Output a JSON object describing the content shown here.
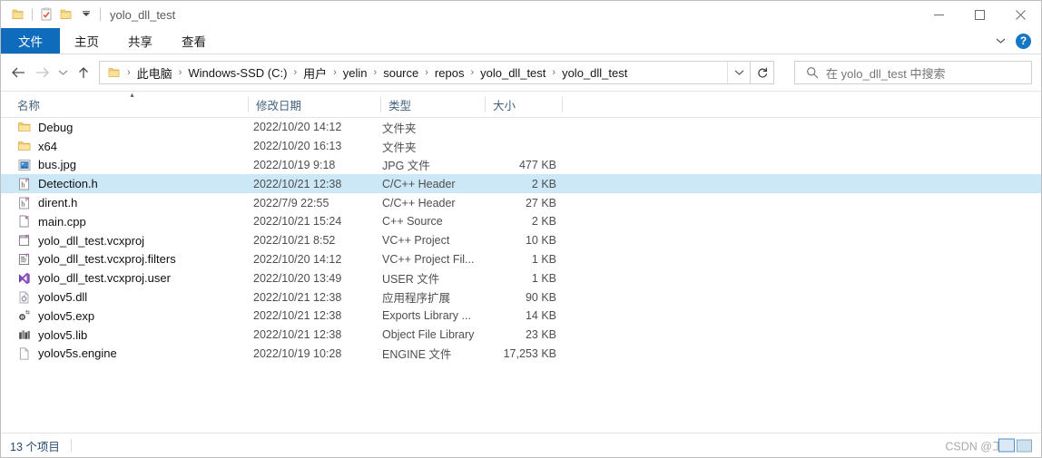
{
  "window": {
    "title": "yolo_dll_test",
    "controls": {
      "minimize": "—",
      "maximize": "□",
      "close": "✕"
    },
    "quick_access": [
      {
        "name": "folder-icon",
        "label": ""
      },
      {
        "name": "properties-icon",
        "label": ""
      },
      {
        "name": "new-folder-icon",
        "label": ""
      },
      {
        "name": "customize-dropdown-icon",
        "label": "▾"
      }
    ]
  },
  "ribbon": {
    "tabs": [
      {
        "label": "文件",
        "id": "file",
        "active": true
      },
      {
        "label": "主页",
        "id": "home",
        "active": false
      },
      {
        "label": "共享",
        "id": "share",
        "active": false
      },
      {
        "label": "查看",
        "id": "view",
        "active": false
      }
    ],
    "collapse_icon": "⌄",
    "help_icon": "?"
  },
  "addressbar": {
    "back": "←",
    "forward": "→",
    "recent": "⌄",
    "up": "↑",
    "breadcrumbs": [
      "此电脑",
      "Windows-SSD (C:)",
      "用户",
      "yelin",
      "source",
      "repos",
      "yolo_dll_test",
      "yolo_dll_test"
    ],
    "separator": "›",
    "dropdown": "⌄",
    "refresh": "↻"
  },
  "search": {
    "placeholder": "在 yolo_dll_test 中搜索",
    "icon": "search-icon"
  },
  "columns": [
    {
      "key": "name",
      "label": "名称",
      "sorted": "asc"
    },
    {
      "key": "date",
      "label": "修改日期"
    },
    {
      "key": "type",
      "label": "类型"
    },
    {
      "key": "size",
      "label": "大小"
    }
  ],
  "sort_caret": "▴",
  "files": [
    {
      "name": "Debug",
      "date": "2022/10/20 14:12",
      "type": "文件夹",
      "size": "",
      "icon": "folder",
      "selected": false
    },
    {
      "name": "x64",
      "date": "2022/10/20 16:13",
      "type": "文件夹",
      "size": "",
      "icon": "folder",
      "selected": false
    },
    {
      "name": "bus.jpg",
      "date": "2022/10/19 9:18",
      "type": "JPG 文件",
      "size": "477 KB",
      "icon": "image",
      "selected": false
    },
    {
      "name": "Detection.h",
      "date": "2022/10/21 12:38",
      "type": "C/C++ Header",
      "size": "2 KB",
      "icon": "header",
      "selected": true
    },
    {
      "name": "dirent.h",
      "date": "2022/7/9 22:55",
      "type": "C/C++ Header",
      "size": "27 KB",
      "icon": "header",
      "selected": false
    },
    {
      "name": "main.cpp",
      "date": "2022/10/21 15:24",
      "type": "C++ Source",
      "size": "2 KB",
      "icon": "cpp",
      "selected": false
    },
    {
      "name": "yolo_dll_test.vcxproj",
      "date": "2022/10/21 8:52",
      "type": "VC++ Project",
      "size": "10 KB",
      "icon": "vcxproj",
      "selected": false
    },
    {
      "name": "yolo_dll_test.vcxproj.filters",
      "date": "2022/10/20 14:12",
      "type": "VC++ Project Fil...",
      "size": "1 KB",
      "icon": "filters",
      "selected": false
    },
    {
      "name": "yolo_dll_test.vcxproj.user",
      "date": "2022/10/20 13:49",
      "type": "USER 文件",
      "size": "1 KB",
      "icon": "vsuser",
      "selected": false
    },
    {
      "name": "yolov5.dll",
      "date": "2022/10/21 12:38",
      "type": "应用程序扩展",
      "size": "90 KB",
      "icon": "dll",
      "selected": false
    },
    {
      "name": "yolov5.exp",
      "date": "2022/10/21 12:38",
      "type": "Exports Library ...",
      "size": "14 KB",
      "icon": "exp",
      "selected": false
    },
    {
      "name": "yolov5.lib",
      "date": "2022/10/21 12:38",
      "type": "Object File Library",
      "size": "23 KB",
      "icon": "lib",
      "selected": false
    },
    {
      "name": "yolov5s.engine",
      "date": "2022/10/19 10:28",
      "type": "ENGINE 文件",
      "size": "17,253 KB",
      "icon": "blank",
      "selected": false
    }
  ],
  "statusbar": {
    "item_count": "13 个项目"
  },
  "watermark": {
    "text": "CSDN @工程"
  },
  "colors": {
    "accent": "#0f6cbd",
    "selection": "#cce8f7",
    "header_text": "#43617f",
    "status_text": "#2b4b6b"
  }
}
